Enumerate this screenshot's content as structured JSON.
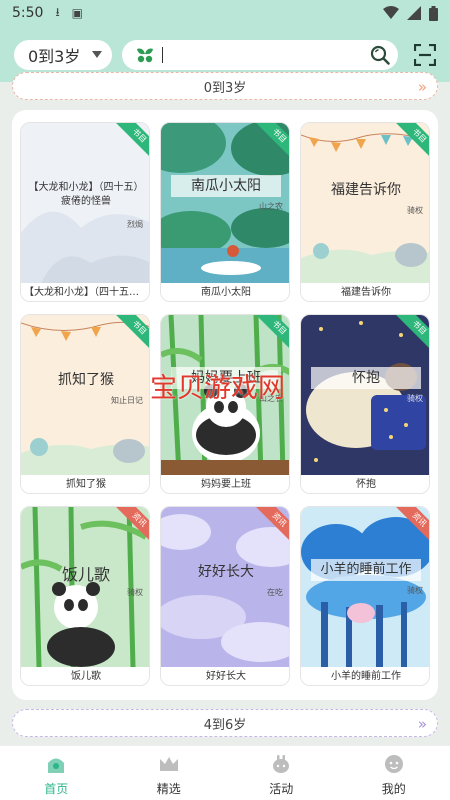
{
  "status_bar": {
    "time": "5:50"
  },
  "header": {
    "age_selected": "0到3岁",
    "search_placeholder": ""
  },
  "sections": {
    "current": {
      "label": "0到3岁"
    },
    "next": {
      "label": "4到6岁"
    }
  },
  "books": [
    {
      "title": "【大龙和小龙】（四十五）疲倦的怪兽",
      "caption": "【大龙和小龙】（四十五）...",
      "author": "烈焗",
      "tag": "书目"
    },
    {
      "title": "南瓜小太阳",
      "caption": "南瓜小太阳",
      "author": "山之农",
      "tag": "书目"
    },
    {
      "title": "福建告诉你",
      "caption": "福建告诉你",
      "author": "骑权",
      "tag": "书目"
    },
    {
      "title": "抓知了猴",
      "caption": "抓知了猴",
      "author": "知止日记",
      "tag": "书目"
    },
    {
      "title": "妈妈要上班",
      "caption": "妈妈要上班",
      "author": "山之农",
      "tag": "书目"
    },
    {
      "title": "怀抱",
      "caption": "怀抱",
      "author": "骑权",
      "tag": "书目"
    },
    {
      "title": "饭儿歌",
      "caption": "饭儿歌",
      "author": "骑权",
      "tag": "资讯"
    },
    {
      "title": "好好长大",
      "caption": "好好长大",
      "author": "在吃",
      "tag": "资讯"
    },
    {
      "title": "小羊的睡前工作",
      "caption": "小羊的睡前工作",
      "author": "骑权",
      "tag": "资讯"
    }
  ],
  "watermark": "宝贝游戏网",
  "nav": [
    {
      "label": "首页",
      "icon": "home-icon",
      "active": true
    },
    {
      "label": "精选",
      "icon": "crown-icon",
      "active": false
    },
    {
      "label": "活动",
      "icon": "activity-icon",
      "active": false
    },
    {
      "label": "我的",
      "icon": "profile-icon",
      "active": false
    }
  ],
  "colors": {
    "accent": "#2bb58a",
    "header_bg": "#b9e6d6",
    "tag_green": "#2eb77a",
    "tag_red": "#e46a5c"
  }
}
